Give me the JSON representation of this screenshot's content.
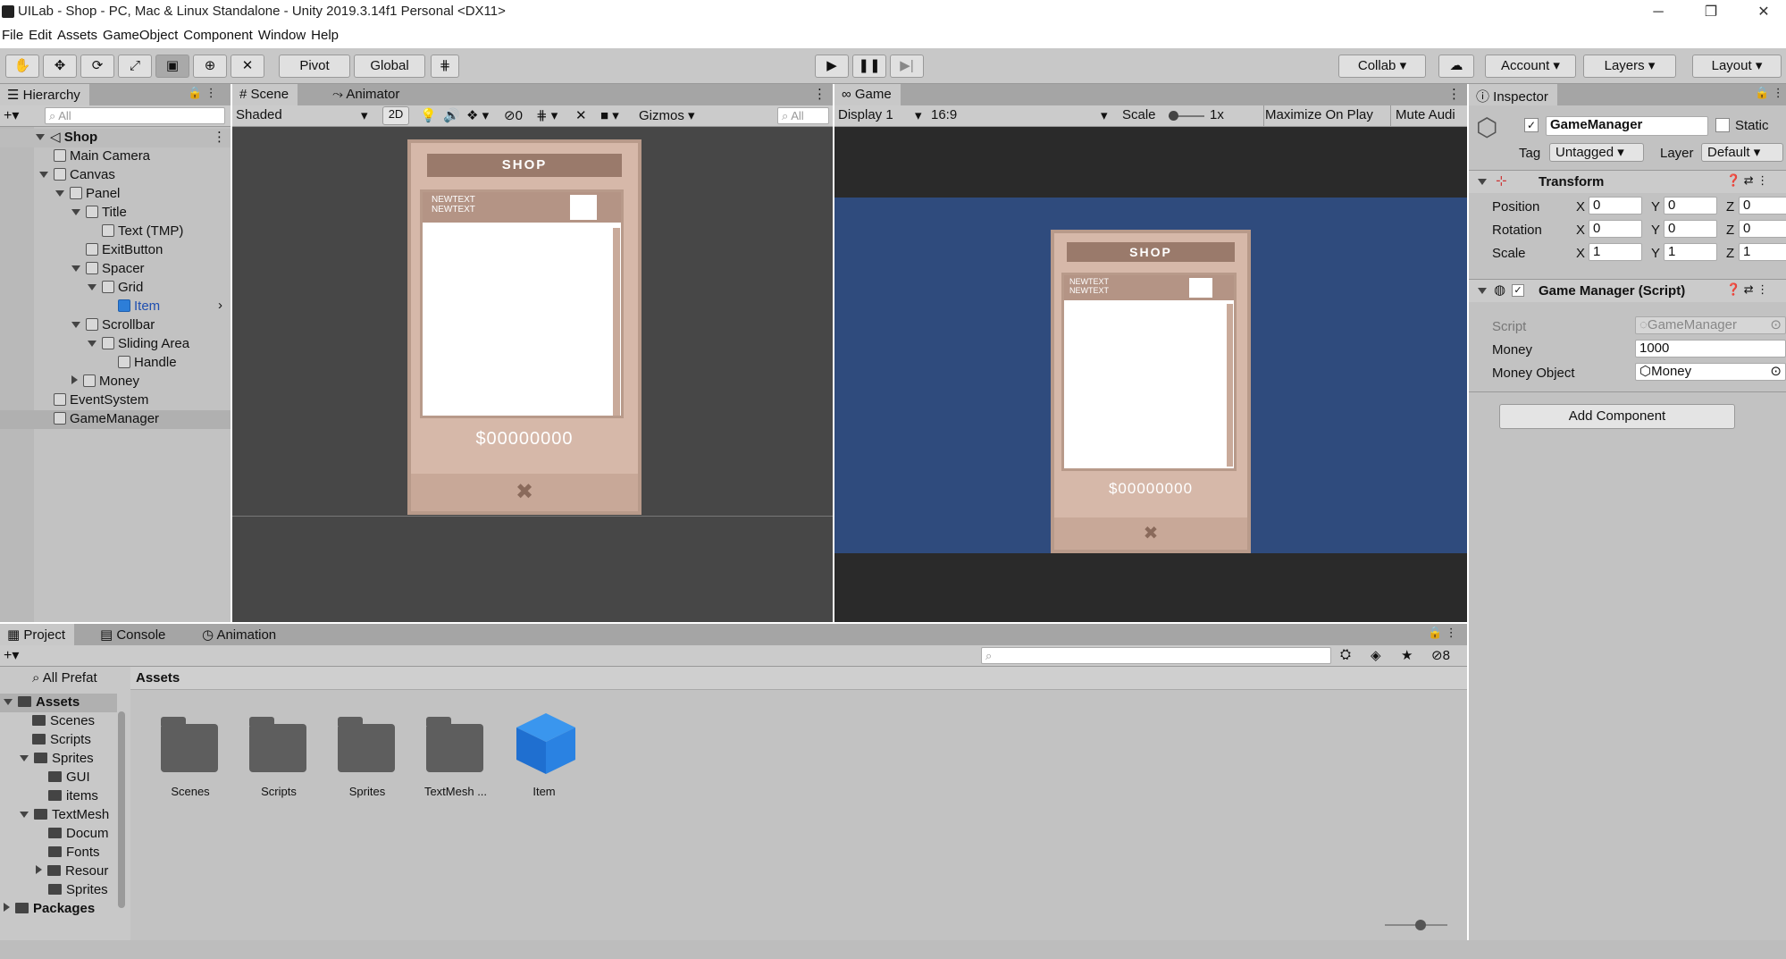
{
  "window": {
    "title": "UILab - Shop - PC, Mac & Linux Standalone - Unity 2019.3.14f1 Personal <DX11>",
    "minimize": "─",
    "maximize": "❐",
    "close": "✕"
  },
  "menu": [
    "File",
    "Edit",
    "Assets",
    "GameObject",
    "Component",
    "Window",
    "Help"
  ],
  "toolbar": {
    "pivot": "Pivot",
    "global": "Global",
    "collab": "Collab",
    "account": "Account",
    "layers": "Layers",
    "layout": "Layout"
  },
  "hierarchy": {
    "tab": "Hierarchy",
    "search_placeholder": "All",
    "scene": "Shop",
    "items": [
      {
        "label": "Main Camera",
        "depth": 1
      },
      {
        "label": "Canvas",
        "depth": 1,
        "expanded": true
      },
      {
        "label": "Panel",
        "depth": 2,
        "expanded": true
      },
      {
        "label": "Title",
        "depth": 3,
        "expanded": true
      },
      {
        "label": "Text (TMP)",
        "depth": 4
      },
      {
        "label": "ExitButton",
        "depth": 3
      },
      {
        "label": "Spacer",
        "depth": 3,
        "expanded": true
      },
      {
        "label": "Grid",
        "depth": 4,
        "expanded": true
      },
      {
        "label": "Item",
        "depth": 5,
        "prefab": true
      },
      {
        "label": "Scrollbar",
        "depth": 3,
        "expanded": true
      },
      {
        "label": "Sliding Area",
        "depth": 4,
        "expanded": true
      },
      {
        "label": "Handle",
        "depth": 5
      },
      {
        "label": "Money",
        "depth": 3,
        "collapsed": true
      },
      {
        "label": "EventSystem",
        "depth": 1
      },
      {
        "label": "GameManager",
        "depth": 1,
        "selected": true
      }
    ]
  },
  "scene": {
    "tab": "Scene",
    "tab2": "Animator",
    "shading": "Shaded",
    "mode2d": "2D",
    "hidden_count": "0",
    "gizmos": "Gizmos",
    "search_placeholder": "All"
  },
  "game": {
    "tab": "Game",
    "display": "Display 1",
    "aspect": "16:9",
    "scale_label": "Scale",
    "scale_value": "1x",
    "maximize": "Maximize On Play",
    "mute": "Mute Audi"
  },
  "shop": {
    "title": "SHOP",
    "item_line1": "NEWTEXT",
    "item_line2": "NEWTEXT",
    "money": "$00000000"
  },
  "inspector": {
    "tab": "Inspector",
    "object_name": "GameManager",
    "static": "Static",
    "tag_label": "Tag",
    "tag_value": "Untagged",
    "layer_label": "Layer",
    "layer_value": "Default",
    "transform": {
      "title": "Transform",
      "position": "Position",
      "rotation": "Rotation",
      "scale": "Scale",
      "x": "X",
      "y": "Y",
      "z": "Z",
      "pos": [
        "0",
        "0",
        "0"
      ],
      "rot": [
        "0",
        "0",
        "0"
      ],
      "scl": [
        "1",
        "1",
        "1"
      ]
    },
    "script_comp": {
      "title": "Game Manager (Script)",
      "script_label": "Script",
      "script_value": "GameManager",
      "money_label": "Money",
      "money_value": "1000",
      "money_obj_label": "Money Object",
      "money_obj_value": "Money"
    },
    "add_component": "Add Component"
  },
  "project": {
    "tabs": [
      "Project",
      "Console",
      "Animation"
    ],
    "hidden_count": "8",
    "favorites": "All Prefat",
    "tree": [
      {
        "label": "Assets",
        "depth": 0,
        "bold": true,
        "expanded": true
      },
      {
        "label": "Scenes",
        "depth": 1
      },
      {
        "label": "Scripts",
        "depth": 1
      },
      {
        "label": "Sprites",
        "depth": 1,
        "expanded": true
      },
      {
        "label": "GUI",
        "depth": 2
      },
      {
        "label": "items",
        "depth": 2
      },
      {
        "label": "TextMesh",
        "depth": 1,
        "expanded": true
      },
      {
        "label": "Docum",
        "depth": 2
      },
      {
        "label": "Fonts",
        "depth": 2
      },
      {
        "label": "Resour",
        "depth": 2,
        "collapsed": true
      },
      {
        "label": "Sprites",
        "depth": 2
      },
      {
        "label": "Packages",
        "depth": 0,
        "bold": true,
        "collapsed": true
      }
    ],
    "breadcrumb": "Assets",
    "assets": [
      {
        "label": "Scenes",
        "type": "folder"
      },
      {
        "label": "Scripts",
        "type": "folder"
      },
      {
        "label": "Sprites",
        "type": "folder"
      },
      {
        "label": "TextMesh ...",
        "type": "folder"
      },
      {
        "label": "Item",
        "type": "prefab"
      }
    ]
  }
}
